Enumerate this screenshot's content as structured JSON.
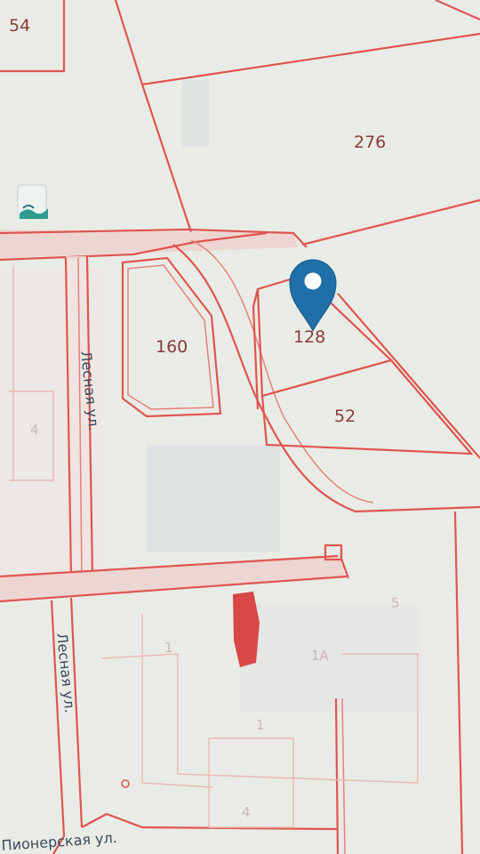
{
  "map": {
    "parcel_labels": {
      "p54": "54",
      "p276": "276",
      "p160": "160",
      "p128": "128",
      "p52": "52",
      "p1a": "1А",
      "p1": "1",
      "p1b": "1",
      "p4": "4",
      "p5": "5",
      "p4left": "4"
    },
    "streets": {
      "lesnaya_upper": "Лесная ул.",
      "lesnaya_lower": "Лесная ул.",
      "pionerskaya": "Пионерская ул."
    },
    "marker": {
      "icon": "map-pin-icon",
      "color": "#1f6fa8"
    },
    "colors": {
      "boundary": "#e0554f",
      "building_highlight": "#d94848",
      "background": "#e9ece6"
    }
  }
}
